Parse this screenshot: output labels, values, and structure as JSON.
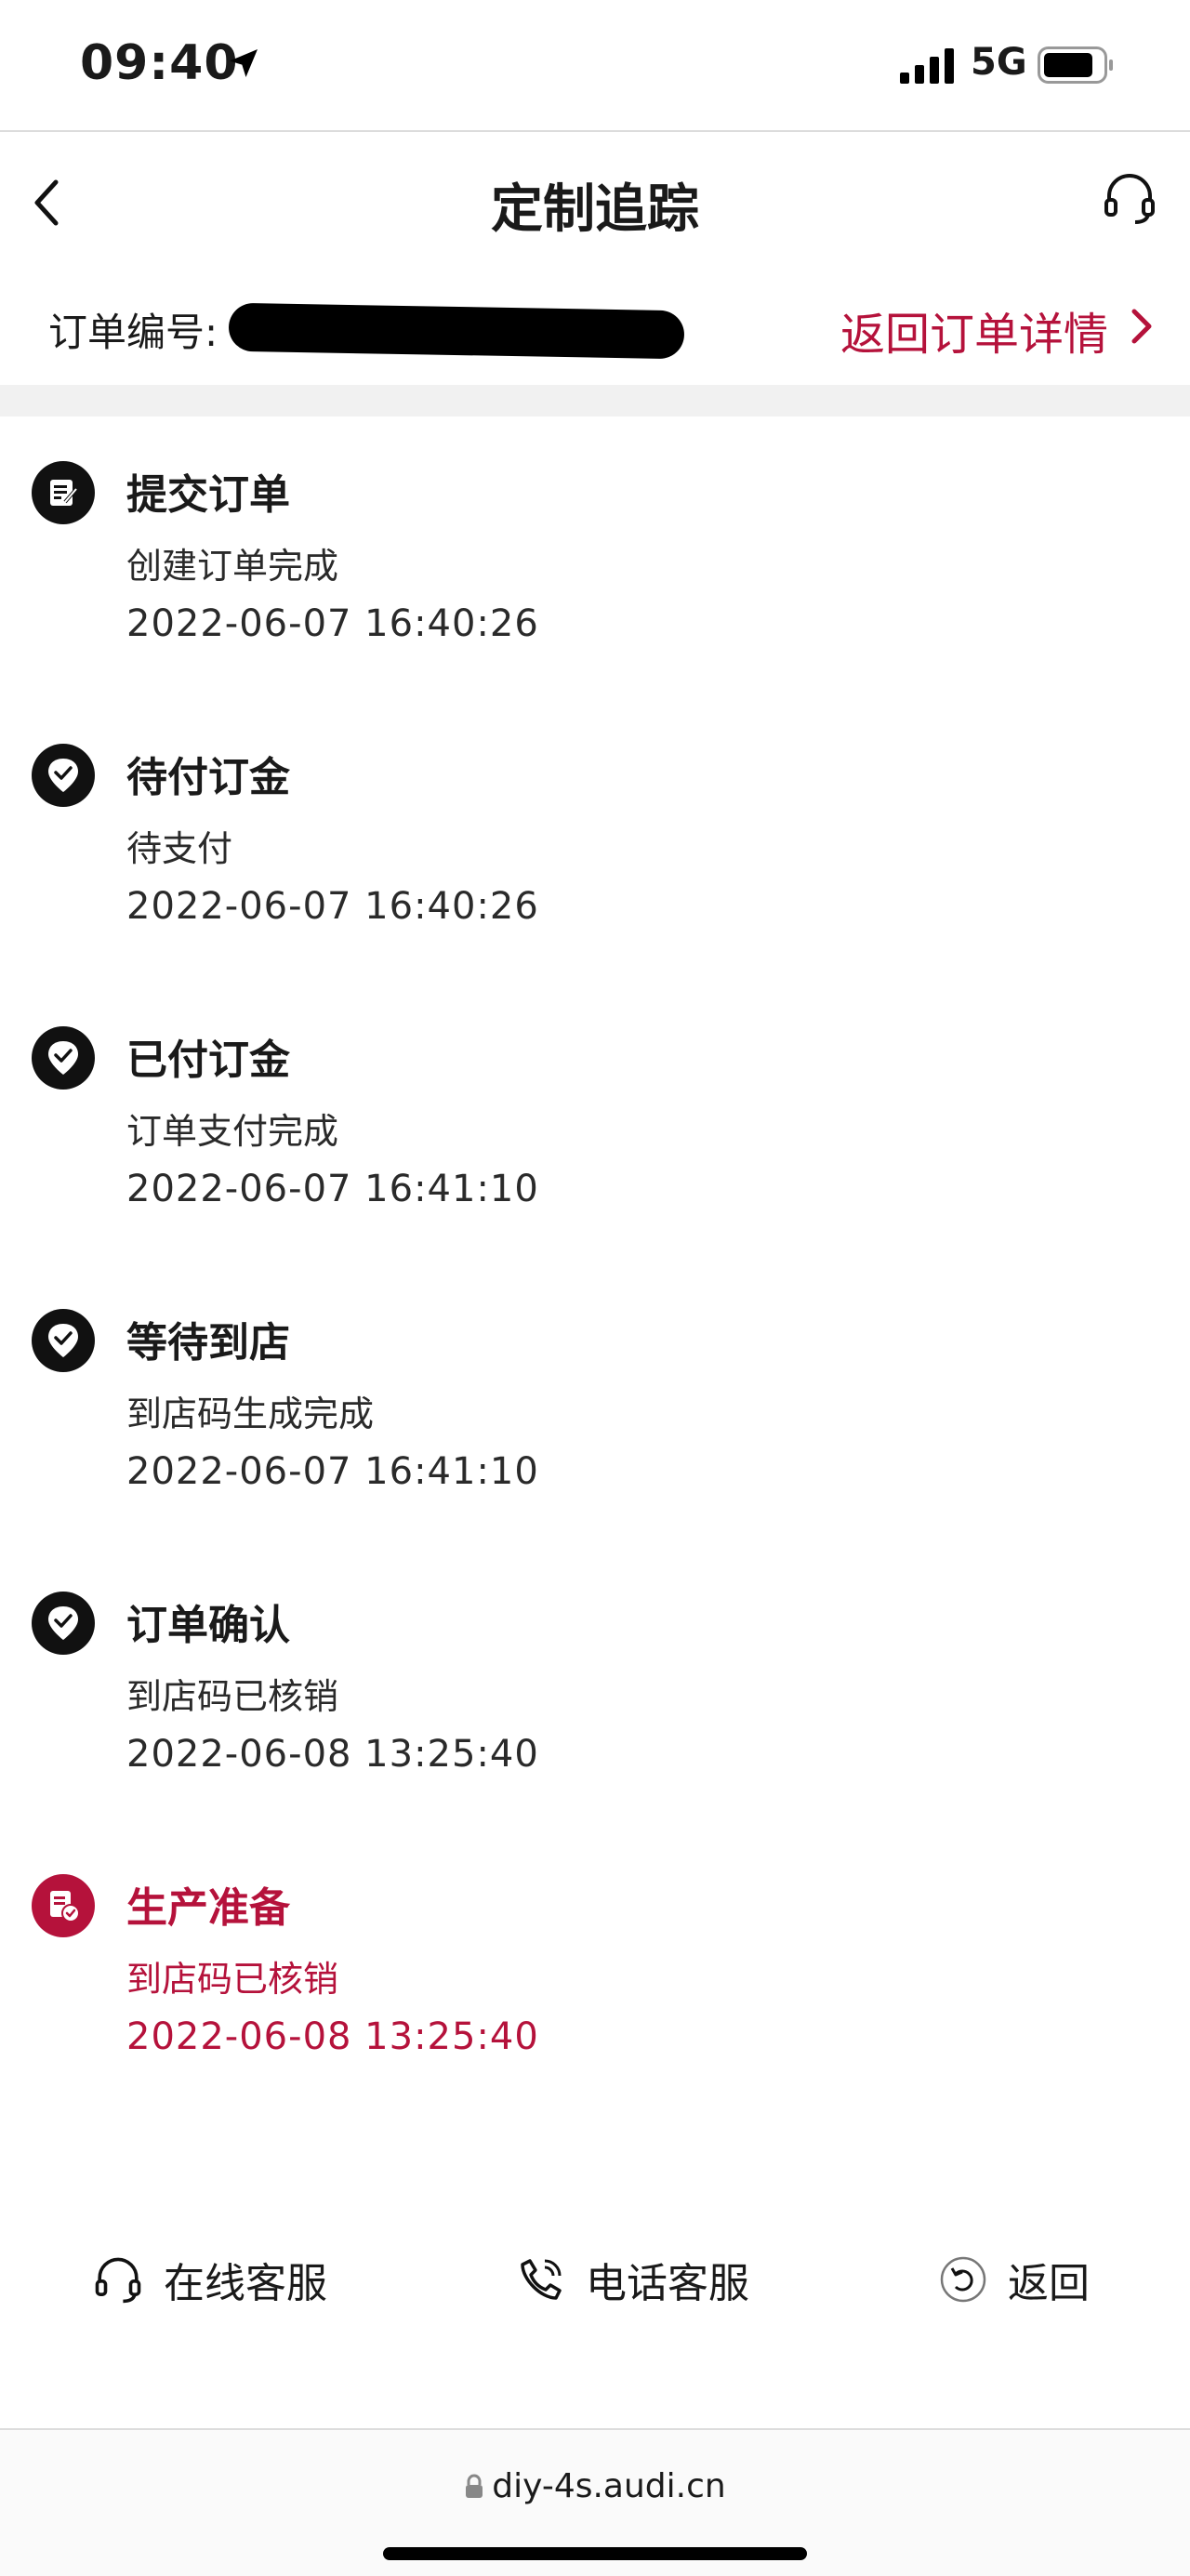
{
  "status_bar": {
    "time": "09:40",
    "network": "5G"
  },
  "header": {
    "title": "定制追踪"
  },
  "order": {
    "label": "订单编号:",
    "return_link": "返回订单详情"
  },
  "timeline": [
    {
      "title": "提交订单",
      "desc": "创建订单完成",
      "time": "2022-06-07 16:40:26",
      "icon": "document-edit-icon",
      "active": false
    },
    {
      "title": "待付订金",
      "desc": "待支付",
      "time": "2022-06-07 16:40:26",
      "icon": "check-shield-icon",
      "active": false
    },
    {
      "title": "已付订金",
      "desc": "订单支付完成",
      "time": "2022-06-07 16:41:10",
      "icon": "check-shield-icon",
      "active": false
    },
    {
      "title": "等待到店",
      "desc": "到店码生成完成",
      "time": "2022-06-07 16:41:10",
      "icon": "check-shield-icon",
      "active": false
    },
    {
      "title": "订单确认",
      "desc": "到店码已核销",
      "time": "2022-06-08 13:25:40",
      "icon": "check-shield-icon",
      "active": false
    },
    {
      "title": "生产准备",
      "desc": "到店码已核销",
      "time": "2022-06-08 13:25:40",
      "icon": "document-check-icon",
      "active": true
    }
  ],
  "actions": {
    "online_service": "在线客服",
    "phone_service": "电话客服",
    "back": "返回"
  },
  "browser": {
    "url": "diy-4s.audi.cn"
  },
  "colors": {
    "accent": "#b5123b",
    "text": "#1a1a1a",
    "band": "#f1f1f1"
  }
}
